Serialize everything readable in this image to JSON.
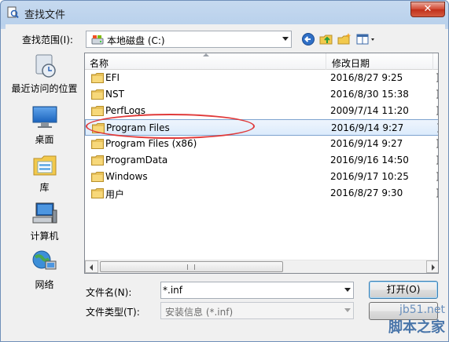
{
  "window": {
    "title": "查找文件",
    "close_label": "✕"
  },
  "toolbar": {
    "lookin_label": "查找范围(I):",
    "lookin_value": "本地磁盘 (C:)",
    "icons": [
      "back-arrow-icon",
      "up-folder-icon",
      "new-folder-icon",
      "view-menu-icon"
    ]
  },
  "places": [
    {
      "label": "最近访问的位置",
      "icon": "recent-places-icon"
    },
    {
      "label": "桌面",
      "icon": "desktop-icon"
    },
    {
      "label": "库",
      "icon": "libraries-icon"
    },
    {
      "label": "计算机",
      "icon": "computer-icon"
    },
    {
      "label": "网络",
      "icon": "network-icon"
    }
  ],
  "filelist": {
    "columns": {
      "name": "名称",
      "date": "修改日期",
      "extra": ""
    },
    "rows": [
      {
        "name": "EFI",
        "date": "2016/8/27 9:25",
        "extra": "]",
        "selected": false
      },
      {
        "name": "NST",
        "date": "2016/8/30 15:38",
        "extra": "]",
        "selected": false
      },
      {
        "name": "PerfLogs",
        "date": "2009/7/14 11:20",
        "extra": "]",
        "selected": false
      },
      {
        "name": "Program Files",
        "date": "2016/9/14 9:27",
        "extra": "]",
        "selected": true
      },
      {
        "name": "Program Files (x86)",
        "date": "2016/9/14 9:27",
        "extra": "]",
        "selected": false
      },
      {
        "name": "ProgramData",
        "date": "2016/9/16 14:50",
        "extra": "]",
        "selected": false
      },
      {
        "name": "Windows",
        "date": "2016/9/17 10:25",
        "extra": "]",
        "selected": false
      },
      {
        "name": "用户",
        "date": "2016/8/27 9:30",
        "extra": "]",
        "selected": false
      }
    ]
  },
  "bottom": {
    "filename_label": "文件名(N):",
    "filename_value": "*.inf",
    "filetype_label": "文件类型(T):",
    "filetype_value": "安装信息 (*.inf)",
    "open_label": "打开(O)",
    "cancel_label": ""
  },
  "watermark": {
    "site": "jb51.net",
    "brand": "脚本之家"
  },
  "colors": {
    "accent": "#3c7fb1",
    "selection": "#dcebfc",
    "annotation": "#e03a3a",
    "folder": "#e8c15a"
  }
}
